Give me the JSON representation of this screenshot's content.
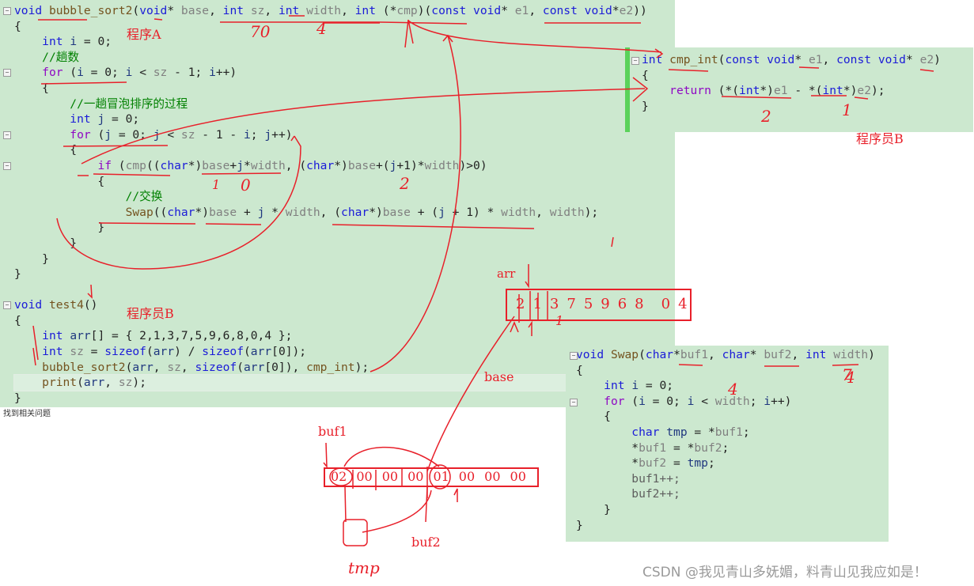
{
  "program_a": {
    "lines": [
      "void bubble_sort2(void* base, int sz, int width, int (*cmp)(const void* e1, const void*e2))",
      "{",
      "    int i = 0;",
      "    //趟数",
      "    for (i = 0; i < sz - 1; i++)",
      "    {",
      "        //一趟冒泡排序的过程",
      "        int j = 0;",
      "        for (j = 0; j < sz - 1 - i; j++)",
      "        {",
      "            if (cmp((char*)base+j*width, (char*)base+(j+1)*width)>0)",
      "            {",
      "                //交换",
      "                Swap((char*)base + j * width, (char*)base + (j + 1) * width, width);",
      "            }",
      "        }",
      "    }",
      "}",
      "",
      "void test4()",
      "{",
      "    int arr[] = { 2,1,3,7,5,9,6,8,0,4 };",
      "    int sz = sizeof(arr) / sizeof(arr[0]);",
      "    bubble_sort2(arr, sz, sizeof(arr[0]), cmp_int);",
      "    print(arr, sz);",
      "}"
    ]
  },
  "program_b": {
    "lines": [
      "int cmp_int(const void* e1, const void* e2)",
      "{",
      "    return (*(int*)e1 - *(int*)e2);",
      "}"
    ]
  },
  "swap_func": {
    "lines": [
      "void Swap(char*buf1, char* buf2, int width)",
      "{",
      "    int i = 0;",
      "    for (i = 0; i < width; i++)",
      "    {",
      "        char tmp = *buf1;",
      "        *buf1 = *buf2;",
      "        *buf2 = tmp;",
      "        buf1++;",
      "        buf2++;",
      "    }",
      "}"
    ]
  },
  "status_text": "找到相关问题",
  "watermark": "CSDN @我见青山多妩媚，料青山见我应如是！",
  "annotations": {
    "label_program_a": "程序A",
    "label_programmer_b_left": "程序员B",
    "label_programmer_b_right": "程序员B",
    "label_arr": "arr",
    "label_base": "base",
    "label_buf1": "buf1",
    "label_buf2": "buf2",
    "label_tmp": "tmp",
    "array_values": [
      "2",
      "1",
      "3",
      "7",
      "5",
      "9",
      "6",
      "8",
      "0",
      "4"
    ],
    "memory_bytes": [
      "02",
      "00",
      "00",
      "00",
      "01",
      "00",
      "00",
      "00"
    ],
    "hand_marks": [
      "70",
      "4",
      "4",
      "1",
      "0",
      "2",
      "1",
      "2",
      "1",
      "4",
      "7"
    ]
  },
  "colors": {
    "code_bg": "#cce8cf",
    "annotation": "#e8202a",
    "keyword": "#1b1bd8",
    "control": "#8f08c4",
    "comment": "#008000",
    "change_bar": "#5ad25a"
  }
}
